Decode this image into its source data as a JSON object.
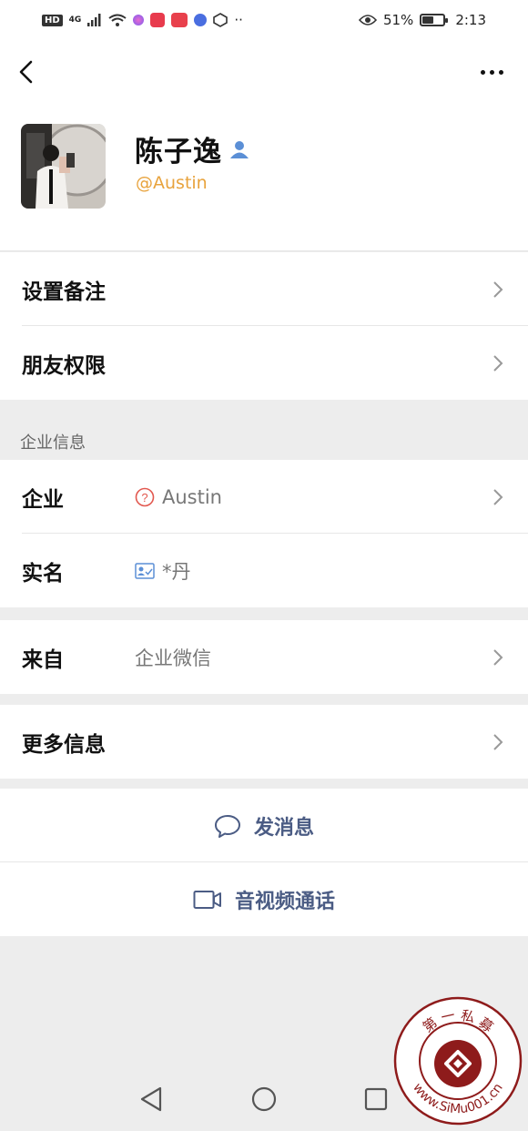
{
  "status_bar": {
    "network": "4G",
    "battery": "51%",
    "battery_level": 0.51,
    "time": "2:13",
    "hd": "HD",
    "more": "··"
  },
  "contact": {
    "name": "陈子逸",
    "handle": "@Austin"
  },
  "settings_rows": [
    {
      "label": "设置备注"
    },
    {
      "label": "朋友权限"
    }
  ],
  "enterprise": {
    "section_title": "企业信息",
    "company_label": "企业",
    "company_value": "Austin",
    "realname_label": "实名",
    "realname_value": "*丹"
  },
  "source": {
    "label": "来自",
    "value": "企业微信"
  },
  "more_info": {
    "label": "更多信息"
  },
  "actions": {
    "message": "发消息",
    "call": "音视频通话"
  },
  "watermark": {
    "top_text": "第 一 私 募",
    "url_text": "www.SiMu001.cn"
  },
  "colors": {
    "accent_link": "#4b5c84",
    "handle": "#e8a33d",
    "background": "#ededed"
  }
}
